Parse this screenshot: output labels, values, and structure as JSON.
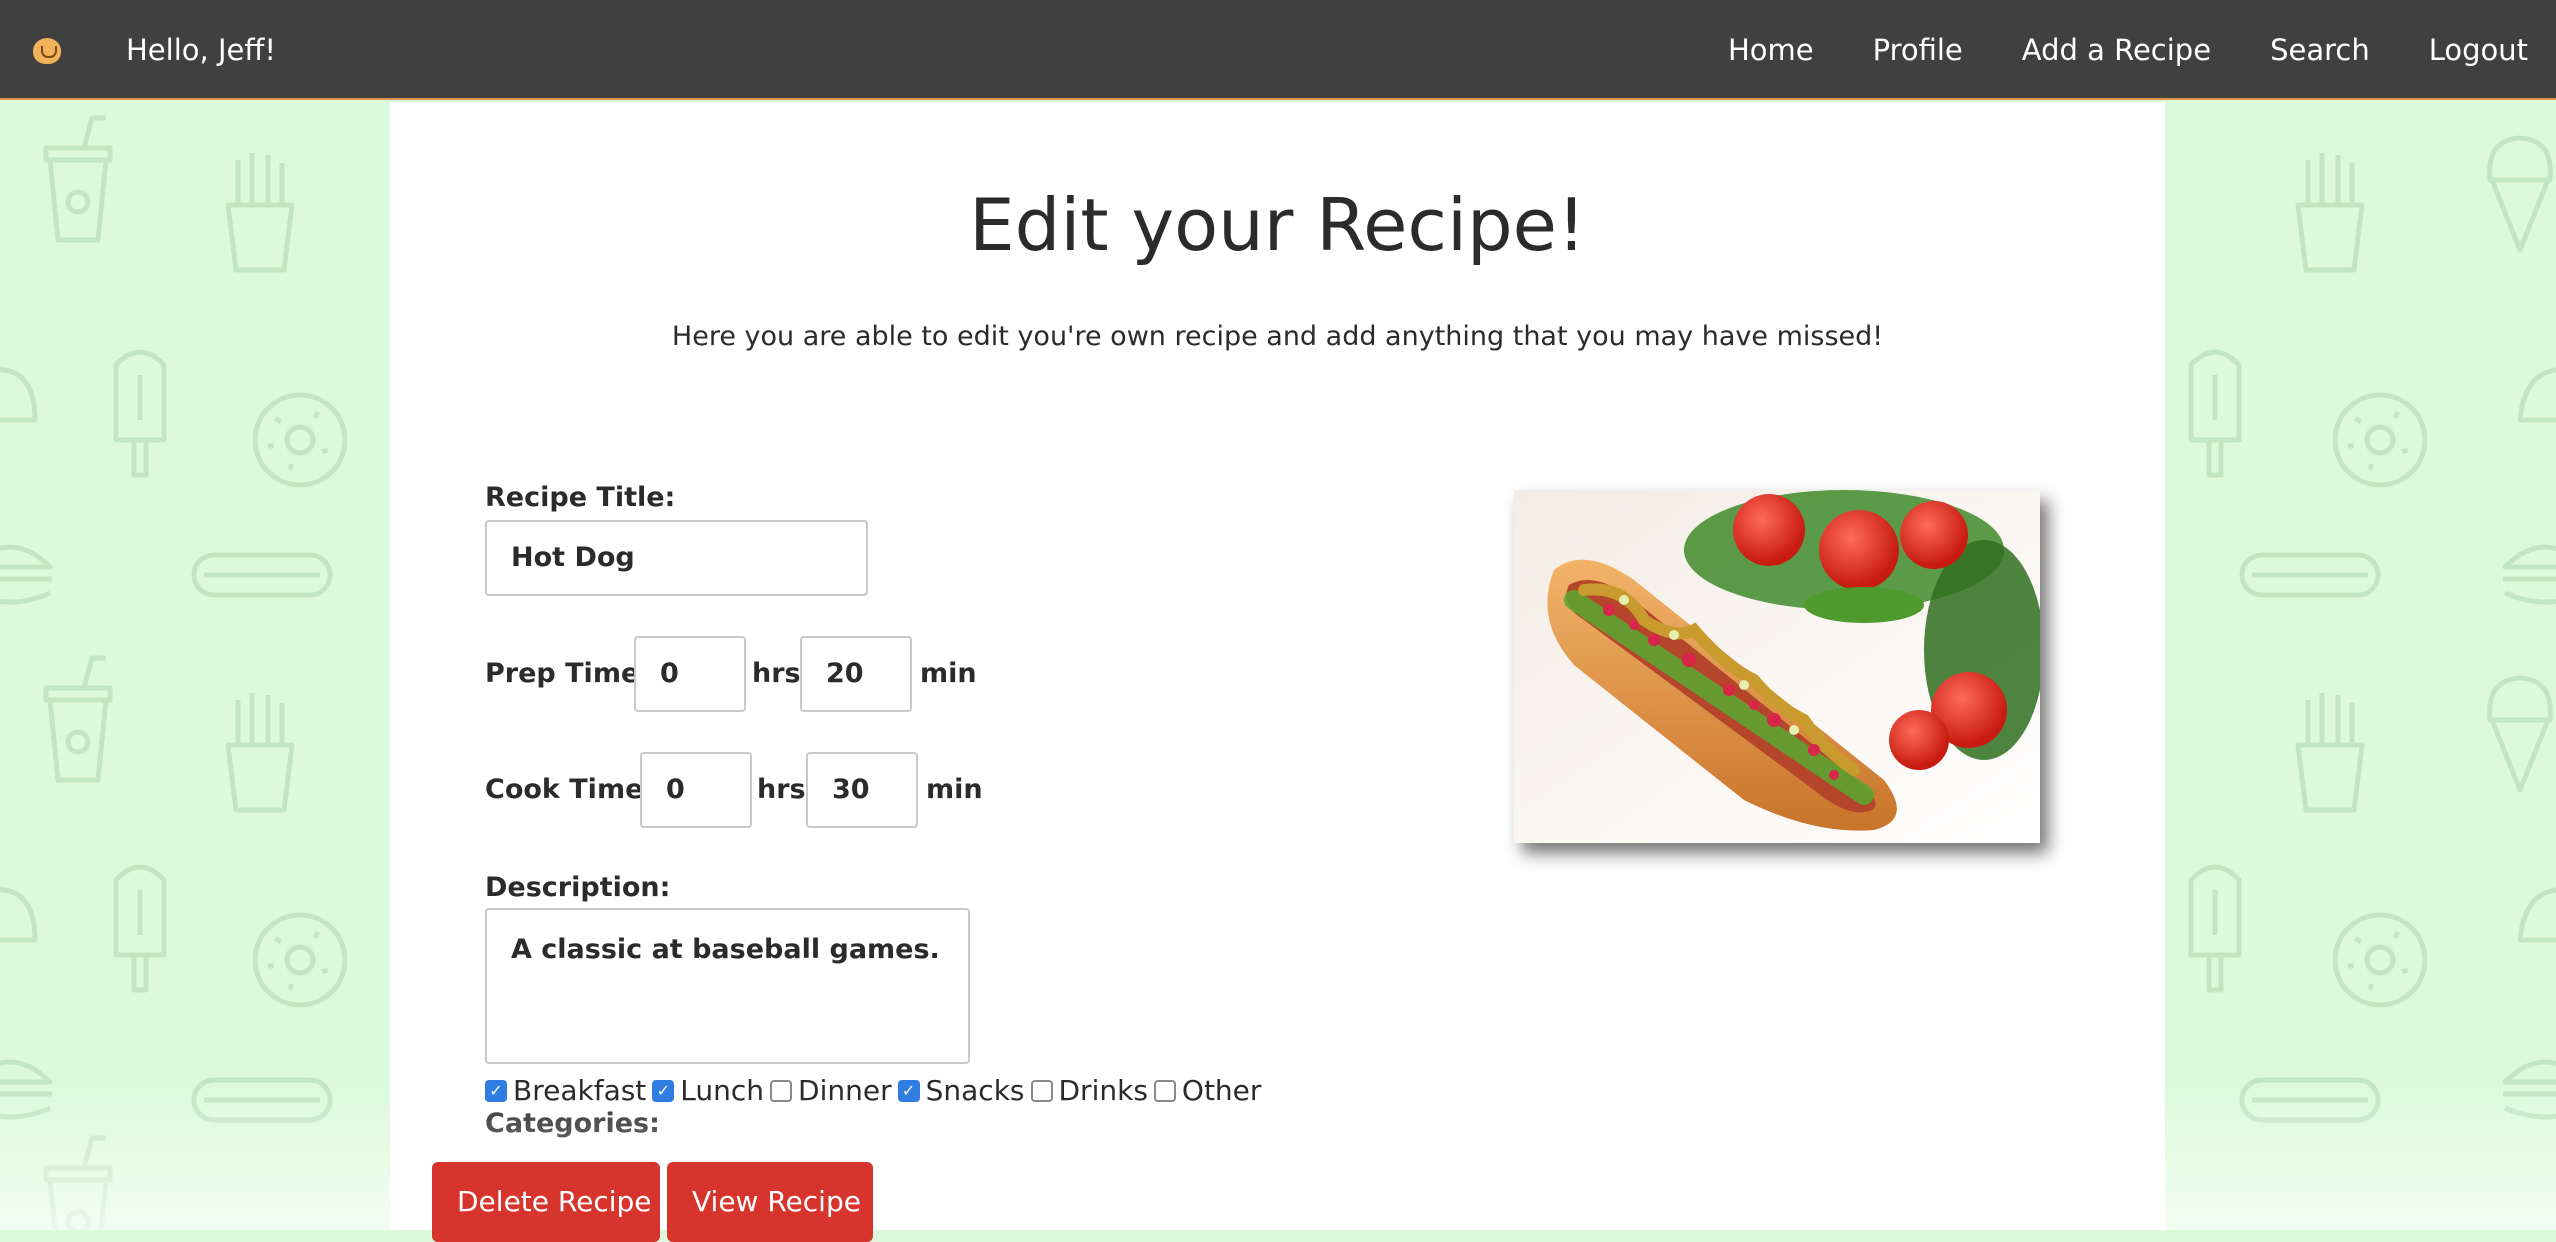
{
  "nav": {
    "greeting": "Hello, Jeff!",
    "links": [
      "Home",
      "Profile",
      "Add a Recipe",
      "Search",
      "Logout"
    ]
  },
  "page": {
    "title": "Edit your Recipe!",
    "subtitle": "Here you are able to edit you're own recipe and add anything that you may have missed!"
  },
  "form": {
    "title_label": "Recipe Title:",
    "title_value": "Hot Dog",
    "prep_label": "Prep Time:",
    "prep_hrs": "0",
    "prep_min": "20",
    "cook_label": "Cook Time:",
    "cook_hrs": "0",
    "cook_min": "30",
    "hrs_unit": "hrs",
    "min_unit": "min",
    "description_label": "Description:",
    "description_value": "A classic at baseball games.",
    "categories_label": "Categories:",
    "categories": [
      {
        "label": "Breakfast",
        "checked": true
      },
      {
        "label": "Lunch",
        "checked": true
      },
      {
        "label": "Dinner",
        "checked": false
      },
      {
        "label": "Snacks",
        "checked": true
      },
      {
        "label": "Drinks",
        "checked": false
      },
      {
        "label": "Other",
        "checked": false
      }
    ]
  },
  "buttons": {
    "delete": "Delete Recipe",
    "view": "View Recipe"
  },
  "image": {
    "icon": "hot-dog-photo"
  },
  "colors": {
    "navbar": "#404040",
    "background": "#dcfadb",
    "button": "#d6342d",
    "checkbox": "#2f7de1"
  }
}
